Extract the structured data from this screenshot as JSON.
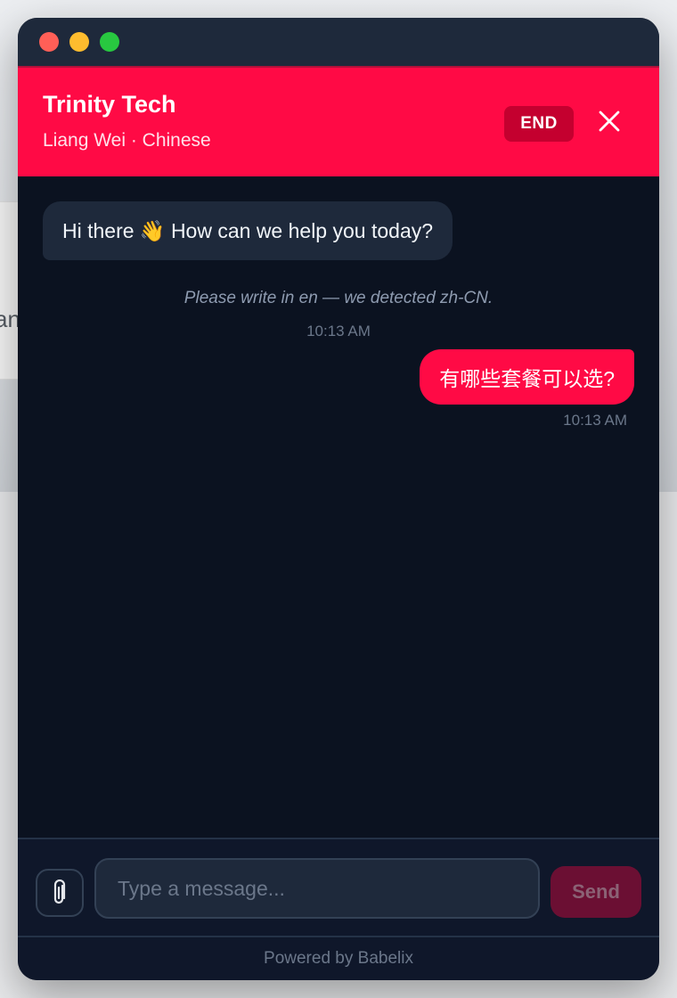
{
  "background": {
    "partial_text": "an"
  },
  "window": {
    "controls": [
      "close",
      "minimize",
      "maximize"
    ]
  },
  "header": {
    "company": "Trinity Tech",
    "agent_line": "Liang Wei · Chinese",
    "end_label": "END",
    "close_icon": "close-icon",
    "accent_color": "#ff0a45"
  },
  "messages": [
    {
      "from": "agent",
      "text": "Hi there 👋 How can we help you today?"
    },
    {
      "from": "system",
      "text": "Please write in en — we detected zh-CN.",
      "time": "10:13 AM"
    },
    {
      "from": "user",
      "text": "有哪些套餐可以选?",
      "time": "10:13 AM"
    }
  ],
  "composer": {
    "attach_icon": "paperclip-icon",
    "placeholder": "Type a message...",
    "value": "",
    "send_label": "Send"
  },
  "footer": {
    "text": "Powered by Babelix"
  }
}
